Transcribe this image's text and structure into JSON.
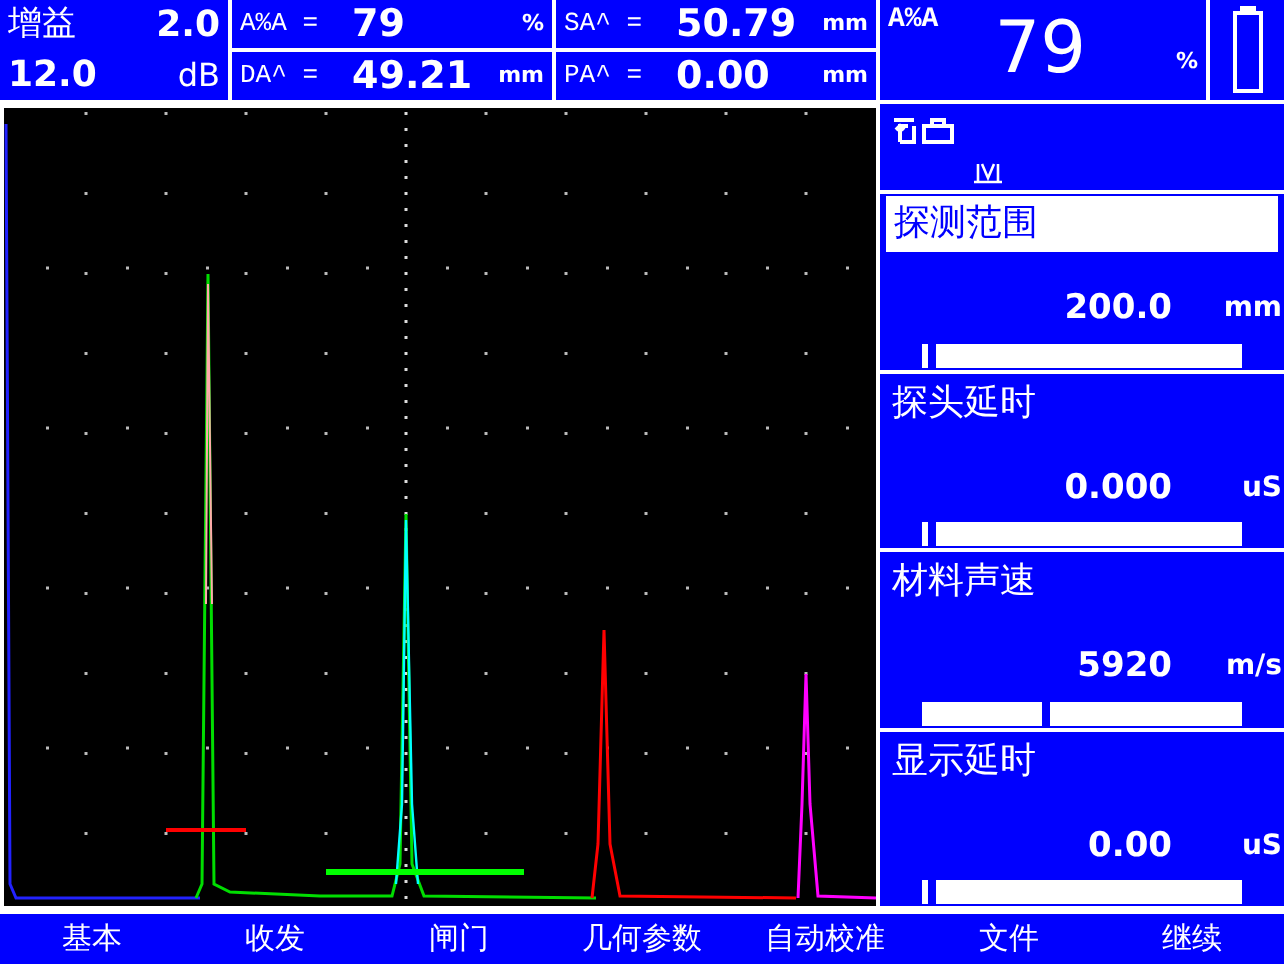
{
  "gain": {
    "label": "增益",
    "step": "2.0",
    "value": "12.0",
    "unit": "dB"
  },
  "readings": [
    {
      "label": "A%A =",
      "value": "79",
      "unit": "%"
    },
    {
      "label": "SA^ =",
      "value": "50.79",
      "unit": "mm"
    },
    {
      "label": "DA^ =",
      "value": "49.21",
      "unit": "mm"
    },
    {
      "label": "PA^ =",
      "value": "0.00",
      "unit": "mm"
    }
  ],
  "big_reading": {
    "label": "A%A",
    "value": "79",
    "unit": "%"
  },
  "params": [
    {
      "label": "探测范围",
      "value": "200.0",
      "unit": "mm",
      "selected": true,
      "level": 0
    },
    {
      "label": "探头延时",
      "value": "0.000",
      "unit": "uS",
      "selected": false,
      "level": 0
    },
    {
      "label": "材料声速",
      "value": "5920",
      "unit": "m/s",
      "selected": false,
      "level": 0.36
    },
    {
      "label": "显示延时",
      "value": "0.00",
      "unit": "uS",
      "selected": false,
      "level": 0
    }
  ],
  "menu": [
    "基本",
    "收发",
    "闸门",
    "几何参数",
    "自动校准",
    "文件",
    "继续"
  ]
}
